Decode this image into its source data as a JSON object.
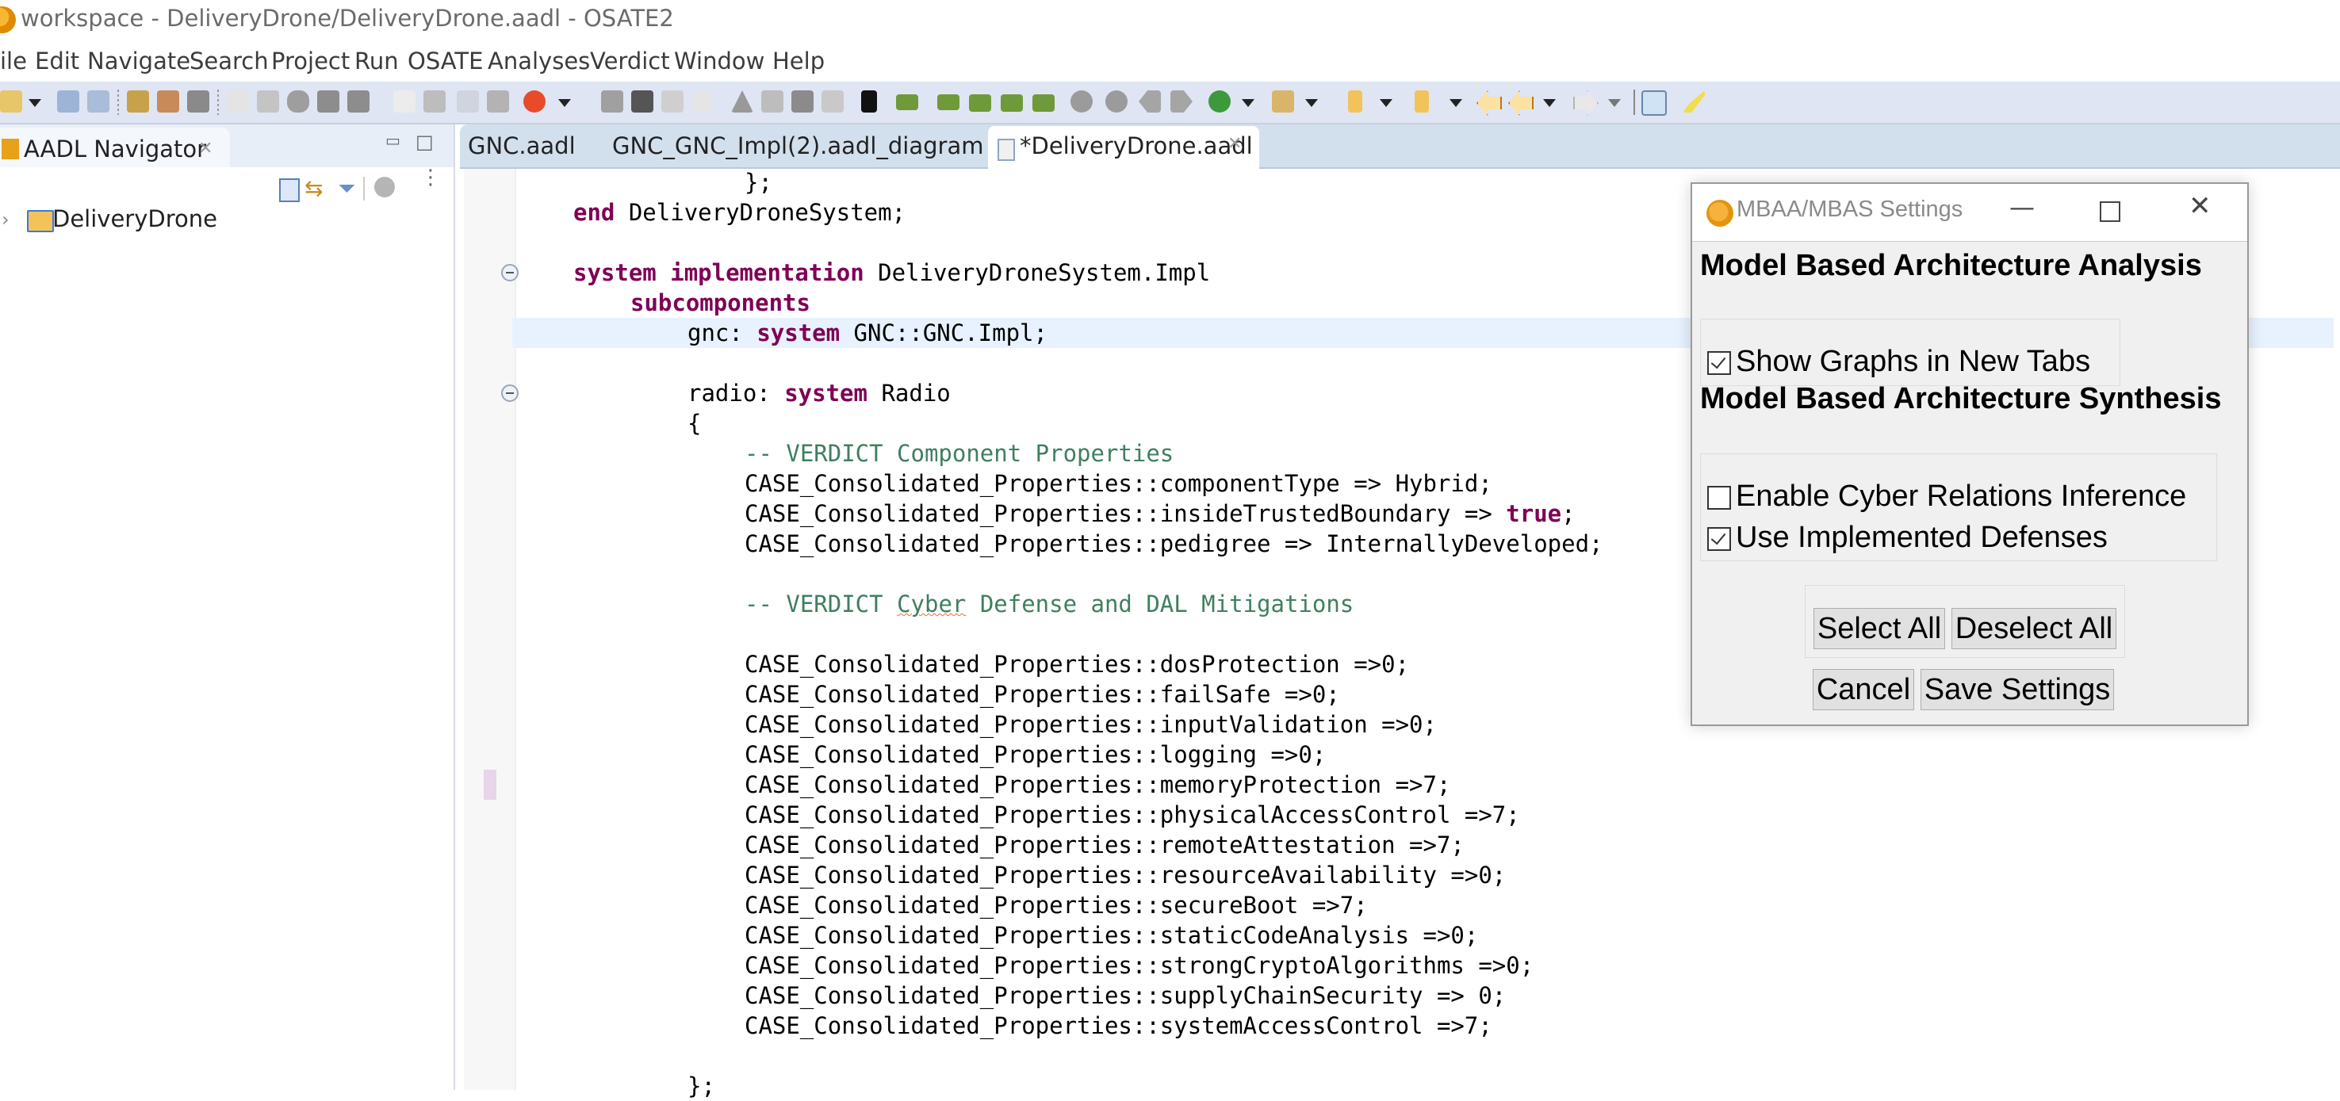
{
  "window": {
    "title": "workspace - DeliveryDrone/DeliveryDrone.aadl - OSATE2"
  },
  "menu": [
    "ile",
    "Edit",
    "Navigate",
    "Search",
    "Project",
    "Run",
    "OSATE",
    "Analyses",
    "Verdict",
    "Window",
    "Help"
  ],
  "navigator": {
    "tab_label": "AADL Navigator",
    "close_glyph": "✕",
    "minimize_glyph": "▭",
    "maximize_glyph": "□",
    "link_glyph": "⇆",
    "filter_glyph": "⏷",
    "view_menu_glyph": "⋮",
    "tree": [
      {
        "label": "DeliveryDrone",
        "expand_glyph": "›",
        "icon": "project-folder-icon"
      }
    ]
  },
  "editor": {
    "tabs": [
      {
        "label": "GNC.aadl",
        "active": false
      },
      {
        "label": "GNC_GNC_Impl(2).aadl_diagram",
        "active": false
      },
      {
        "label": "*DeliveryDrone.aadl",
        "active": true,
        "close_glyph": "✕"
      }
    ],
    "code_lines": [
      {
        "indent": 3,
        "parts": [
          {
            "t": "};"
          }
        ]
      },
      {
        "indent": 0,
        "parts": [
          {
            "t": "end",
            "k": "kw"
          },
          {
            "t": " DeliveryDroneSystem;"
          }
        ]
      },
      {
        "indent": 0,
        "parts": []
      },
      {
        "indent": 0,
        "parts": [
          {
            "t": "system",
            "k": "kw"
          },
          {
            "t": " "
          },
          {
            "t": "implementation",
            "k": "kw"
          },
          {
            "t": " DeliveryDroneSystem.Impl"
          }
        ],
        "fold": true
      },
      {
        "indent": 1,
        "parts": [
          {
            "t": "subcomponents",
            "k": "kw"
          }
        ]
      },
      {
        "indent": 2,
        "parts": [
          {
            "t": "gnc: "
          },
          {
            "t": "system",
            "k": "kw"
          },
          {
            "t": " GNC::GNC.Impl;"
          }
        ],
        "highlight": true
      },
      {
        "indent": 0,
        "parts": []
      },
      {
        "indent": 2,
        "parts": [
          {
            "t": "radio: "
          },
          {
            "t": "system",
            "k": "kw"
          },
          {
            "t": " Radio"
          }
        ],
        "fold": true
      },
      {
        "indent": 2,
        "parts": [
          {
            "t": "{"
          }
        ]
      },
      {
        "indent": 3,
        "parts": [
          {
            "t": "-- VERDICT Component Properties",
            "k": "cm"
          }
        ]
      },
      {
        "indent": 3,
        "parts": [
          {
            "t": "CASE_Consolidated_Properties::componentType => Hybrid;"
          }
        ]
      },
      {
        "indent": 3,
        "parts": [
          {
            "t": "CASE_Consolidated_Properties::insideTrustedBoundary => "
          },
          {
            "t": "true",
            "k": "kw"
          },
          {
            "t": ";"
          }
        ]
      },
      {
        "indent": 3,
        "parts": [
          {
            "t": "CASE_Consolidated_Properties::pedigree => InternallyDeveloped;"
          }
        ]
      },
      {
        "indent": 0,
        "parts": []
      },
      {
        "indent": 3,
        "parts": [
          {
            "t": "-- VERDICT ",
            "k": "cm"
          },
          {
            "t": "Cyber",
            "k": "cm squiggle"
          },
          {
            "t": " Defense and DAL Mitigations",
            "k": "cm"
          }
        ]
      },
      {
        "indent": 0,
        "parts": []
      },
      {
        "indent": 3,
        "parts": [
          {
            "t": "CASE_Consolidated_Properties::dosProtection =>0;"
          }
        ]
      },
      {
        "indent": 3,
        "parts": [
          {
            "t": "CASE_Consolidated_Properties::failSafe =>0;"
          }
        ]
      },
      {
        "indent": 3,
        "parts": [
          {
            "t": "CASE_Consolidated_Properties::inputValidation =>0;"
          }
        ]
      },
      {
        "indent": 3,
        "parts": [
          {
            "t": "CASE_Consolidated_Properties::logging =>0;"
          }
        ]
      },
      {
        "indent": 3,
        "parts": [
          {
            "t": "CASE_Consolidated_Properties::memoryProtection =>7;"
          }
        ],
        "change_marker": true
      },
      {
        "indent": 3,
        "parts": [
          {
            "t": "CASE_Consolidated_Properties::physicalAccessControl =>7;"
          }
        ]
      },
      {
        "indent": 3,
        "parts": [
          {
            "t": "CASE_Consolidated_Properties::remoteAttestation =>7;"
          }
        ]
      },
      {
        "indent": 3,
        "parts": [
          {
            "t": "CASE_Consolidated_Properties::resourceAvailability =>0;"
          }
        ]
      },
      {
        "indent": 3,
        "parts": [
          {
            "t": "CASE_Consolidated_Properties::secureBoot =>7;"
          }
        ]
      },
      {
        "indent": 3,
        "parts": [
          {
            "t": "CASE_Consolidated_Properties::staticCodeAnalysis =>0;"
          }
        ]
      },
      {
        "indent": 3,
        "parts": [
          {
            "t": "CASE_Consolidated_Properties::strongCryptoAlgorithms =>0;"
          }
        ]
      },
      {
        "indent": 3,
        "parts": [
          {
            "t": "CASE_Consolidated_Properties::supplyChainSecurity => 0;"
          }
        ]
      },
      {
        "indent": 3,
        "parts": [
          {
            "t": "CASE_Consolidated_Properties::systemAccessControl =>7;"
          }
        ]
      },
      {
        "indent": 0,
        "parts": []
      },
      {
        "indent": 2,
        "parts": [
          {
            "t": "};"
          }
        ]
      }
    ]
  },
  "dialog": {
    "title": "MBAA/MBAS Settings",
    "minimize_glyph": "—",
    "close_glyph": "✕",
    "mbaa_heading": "Model Based Architecture Analysis",
    "mbas_heading": "Model Based Architecture Synthesis",
    "options": {
      "show_graphs": {
        "label": "Show Graphs in New Tabs",
        "checked": true
      },
      "cyber_inference": {
        "label": "Enable Cyber Relations Inference",
        "checked": false
      },
      "implemented_defenses": {
        "label": "Use Implemented Defenses",
        "checked": true
      }
    },
    "buttons": {
      "select_all": "Select All",
      "deselect_all": "Deselect All",
      "cancel": "Cancel",
      "save": "Save Settings"
    }
  },
  "colors": {
    "keyword": "#7f0055",
    "comment": "#3f7f5f",
    "current_line": "#e8f2fe",
    "toolbar_bg": "#dfe5f3",
    "editor_tabstrip_bg": "#d2e0ee",
    "dialog_bg": "#f0f0f0"
  }
}
